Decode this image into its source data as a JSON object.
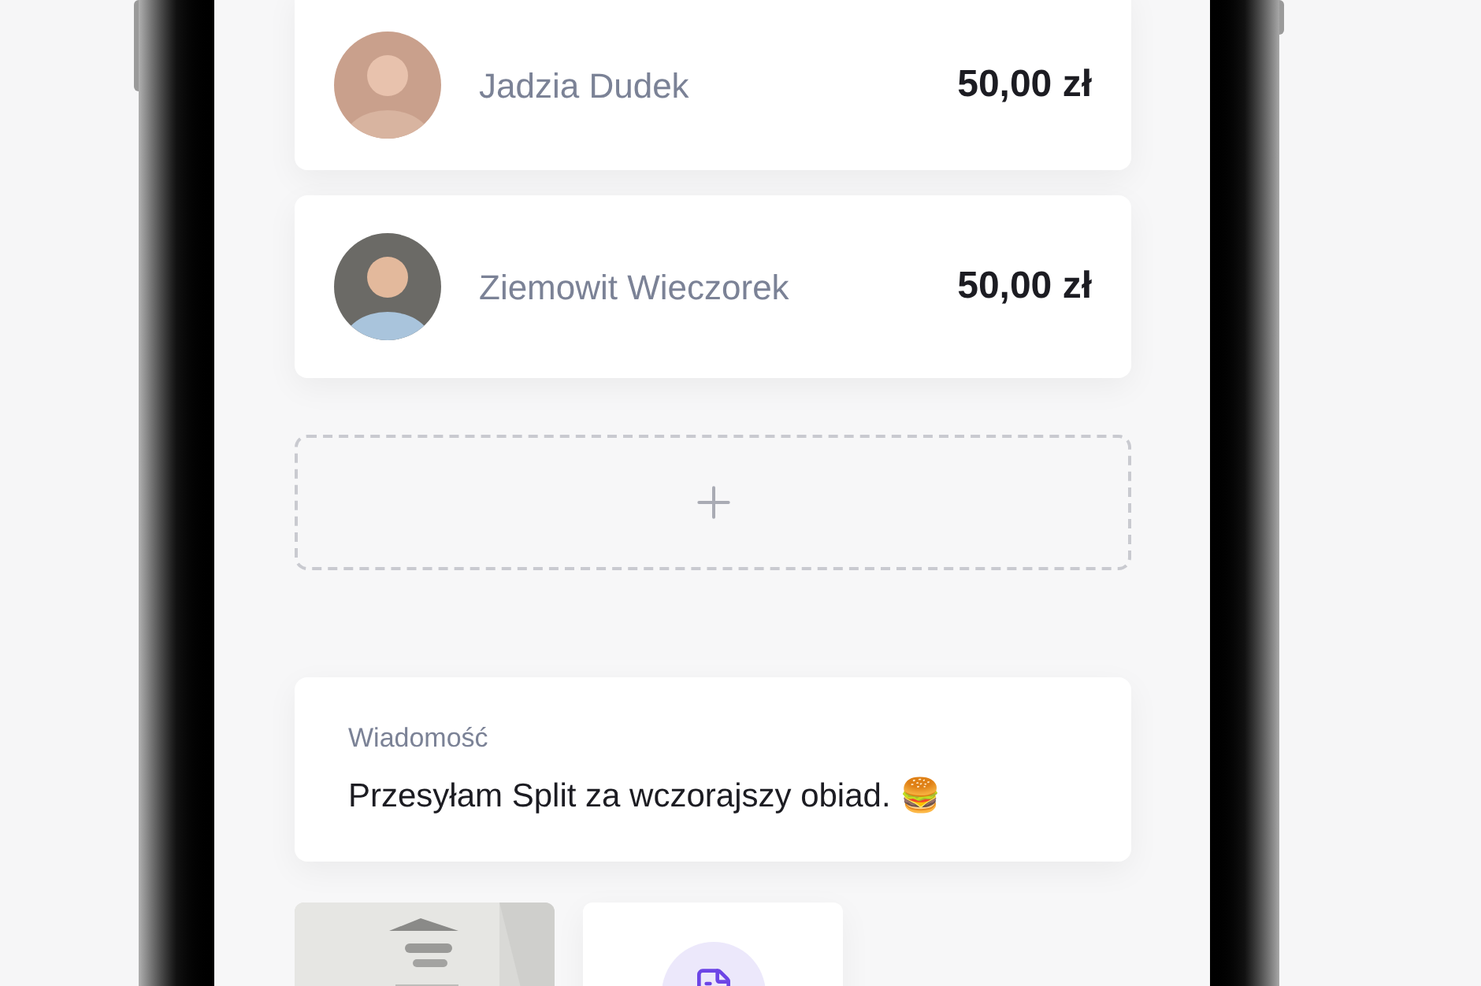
{
  "participants": [
    {
      "name": "Jadzia Dudek",
      "amount": "50,00 zł"
    },
    {
      "name": "Ziemowit Wieczorek",
      "amount": "50,00 zł"
    }
  ],
  "message": {
    "label": "Wiadomość",
    "text": "Przesyłam Split za wczorajszy obiad. 🍔"
  },
  "attachments": [
    {
      "kind": "picture"
    },
    {
      "kind": "file"
    }
  ]
}
